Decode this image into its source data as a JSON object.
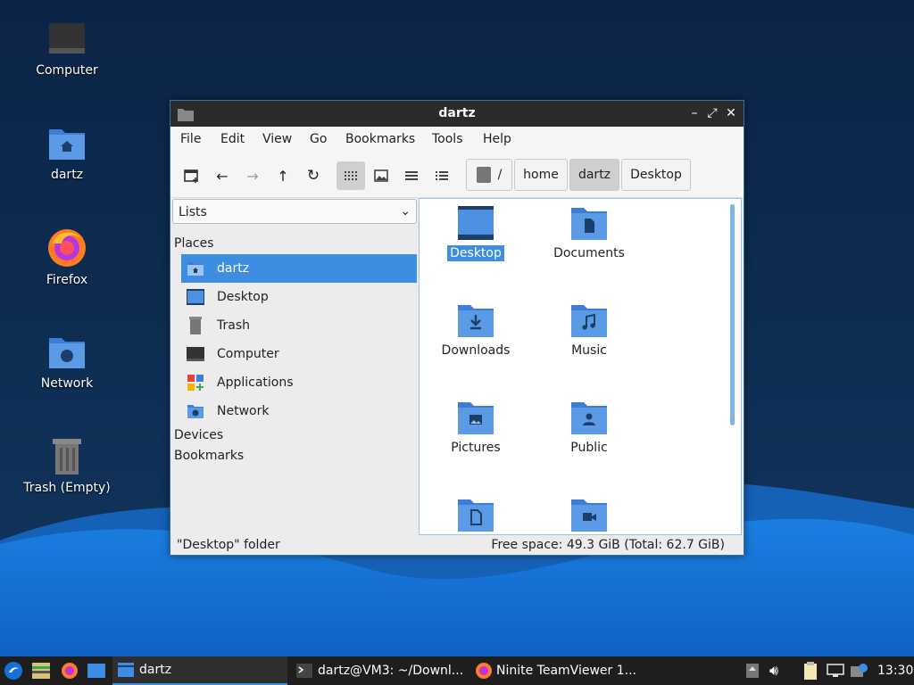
{
  "desktop": {
    "icons": [
      {
        "label": "Computer"
      },
      {
        "label": "dartz"
      },
      {
        "label": "Firefox"
      },
      {
        "label": "Network"
      },
      {
        "label": "Trash (Empty)"
      }
    ]
  },
  "window": {
    "title": "dartz",
    "controls": {
      "minimize": "–",
      "maximize": "⤢",
      "close": "✕"
    },
    "menu": [
      "File",
      "Edit",
      "View",
      "Go",
      "Bookmarks",
      "Tools",
      "Help"
    ],
    "breadcrumbs": {
      "root": "/",
      "items": [
        "home",
        "dartz",
        "Desktop"
      ],
      "selected": "dartz"
    },
    "side_pane": {
      "mode": "Lists",
      "places_heading": "Places",
      "places": [
        "dartz",
        "Desktop",
        "Trash",
        "Computer",
        "Applications",
        "Network"
      ],
      "selected_place": "dartz",
      "devices_heading": "Devices",
      "bookmarks_heading": "Bookmarks"
    },
    "files": [
      "Desktop",
      "Documents",
      "Downloads",
      "Music",
      "Pictures",
      "Public",
      "",
      ""
    ],
    "selected_file": "Desktop",
    "status": {
      "left": "\"Desktop\" folder",
      "right": "Free space: 49.3 GiB (Total: 62.7 GiB)"
    }
  },
  "taskbar": {
    "tasks": [
      "dartz",
      "dartz@VM3: ~/Downl...",
      "Ninite TeamViewer 1..."
    ],
    "clock": "13:30"
  },
  "colors": {
    "accent": "#3d8ee3",
    "folder": "#3d7dd8",
    "folder_tab": "#5b9be6",
    "titlebar": "#2b2b2b"
  }
}
